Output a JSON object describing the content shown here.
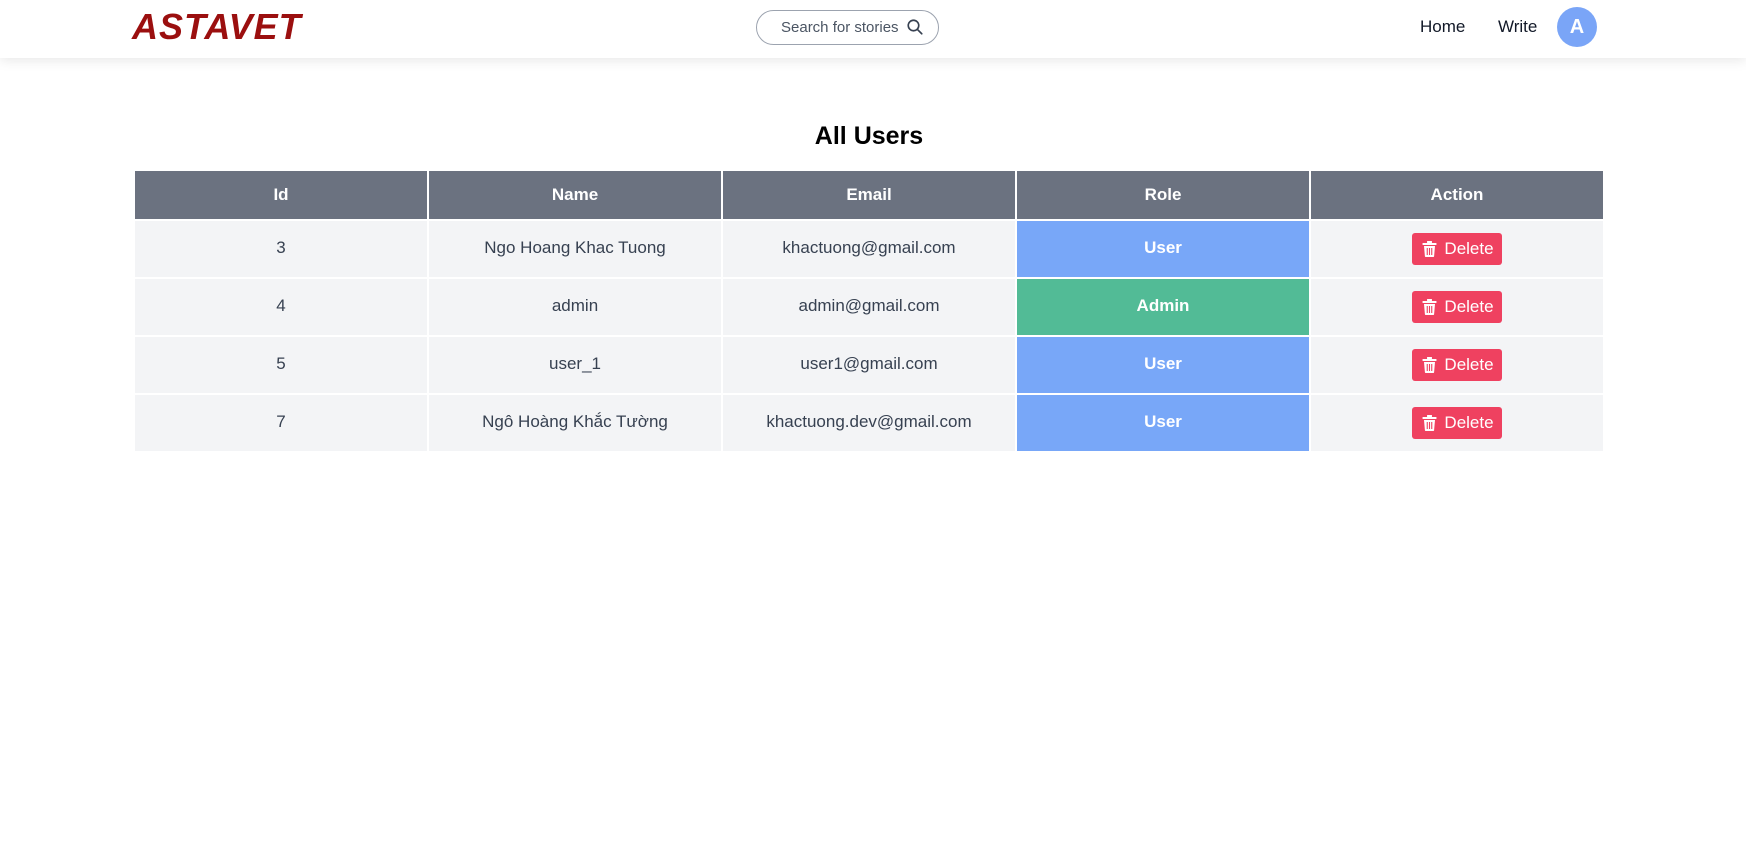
{
  "brand": {
    "logo_text": "ASTAVET",
    "logo_color": "#9b0f0f"
  },
  "search": {
    "placeholder": "Search for stories",
    "icon": "search-icon"
  },
  "nav": {
    "home": "Home",
    "write": "Write",
    "avatar_initial": "A",
    "avatar_color": "#7aa5f7"
  },
  "page": {
    "title": "All Users"
  },
  "table": {
    "headers": [
      "Id",
      "Name",
      "Email",
      "Role",
      "Action"
    ],
    "rows": [
      {
        "id": "3",
        "name": "Ngo Hoang Khac Tuong",
        "email": "khactuong@gmail.com",
        "role": "User",
        "action": "Delete"
      },
      {
        "id": "4",
        "name": "admin",
        "email": "admin@gmail.com",
        "role": "Admin",
        "action": "Delete"
      },
      {
        "id": "5",
        "name": "user_1",
        "email": "user1@gmail.com",
        "role": "User",
        "action": "Delete"
      },
      {
        "id": "7",
        "name": "Ngô Hoàng Khắc Tường",
        "email": "khactuong.dev@gmail.com",
        "role": "User",
        "action": "Delete"
      }
    ]
  },
  "colors": {
    "header_bg": "#6b7280",
    "role_user": "#78a7f8",
    "role_admin": "#52bb96",
    "delete_button": "#ef4160",
    "row_bg": "#f3f4f6"
  },
  "icons": {
    "delete": "trash-icon"
  }
}
